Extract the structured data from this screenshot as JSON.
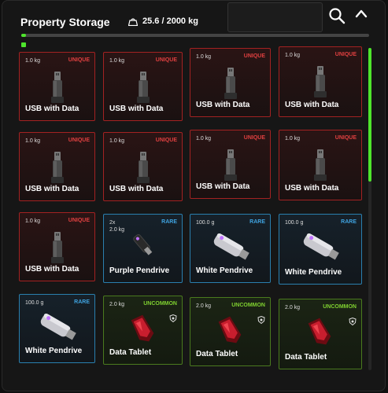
{
  "header": {
    "title": "Property Storage",
    "weight_text": "25.6 / 2000 kg",
    "search_placeholder": ""
  },
  "capacity": {
    "used_kg": 25.6,
    "max_kg": 2000
  },
  "colors": {
    "accent": "#4ee52c",
    "unique": "#e04040",
    "rare": "#3fa3e0",
    "uncommon": "#7fd030"
  },
  "items": [
    {
      "weight": "1.0 kg",
      "rarity": "UNIQUE",
      "name": "USB with Data",
      "icon": "usb-drive-icon"
    },
    {
      "weight": "1.0 kg",
      "rarity": "UNIQUE",
      "name": "USB with Data",
      "icon": "usb-drive-icon"
    },
    {
      "weight": "1.0 kg",
      "rarity": "UNIQUE",
      "name": "USB with Data",
      "icon": "usb-drive-icon"
    },
    {
      "weight": "1.0 kg",
      "rarity": "UNIQUE",
      "name": "USB with Data",
      "icon": "usb-drive-icon"
    },
    {
      "weight": "1.0 kg",
      "rarity": "UNIQUE",
      "name": "USB with Data",
      "icon": "usb-drive-icon"
    },
    {
      "weight": "1.0 kg",
      "rarity": "UNIQUE",
      "name": "USB with Data",
      "icon": "usb-drive-icon"
    },
    {
      "weight": "1.0 kg",
      "rarity": "UNIQUE",
      "name": "USB with Data",
      "icon": "usb-drive-icon"
    },
    {
      "weight": "1.0 kg",
      "rarity": "UNIQUE",
      "name": "USB with Data",
      "icon": "usb-drive-icon"
    },
    {
      "weight": "1.0 kg",
      "rarity": "UNIQUE",
      "name": "USB with Data",
      "icon": "usb-drive-icon"
    },
    {
      "count": "2x",
      "weight": "2.0 kg",
      "rarity": "RARE",
      "name": "Purple Pendrive",
      "icon": "purple-pendrive-icon"
    },
    {
      "weight": "100.0 g",
      "rarity": "RARE",
      "name": "White Pendrive",
      "icon": "white-pendrive-icon"
    },
    {
      "weight": "100.0 g",
      "rarity": "RARE",
      "name": "White Pendrive",
      "icon": "white-pendrive-icon"
    },
    {
      "weight": "100.0 g",
      "rarity": "RARE",
      "name": "White Pendrive",
      "icon": "white-pendrive-icon"
    },
    {
      "weight": "2.0 kg",
      "rarity": "UNCOMMON",
      "name": "Data Tablet",
      "icon": "data-tablet-icon"
    },
    {
      "weight": "2.0 kg",
      "rarity": "UNCOMMON",
      "name": "Data Tablet",
      "icon": "data-tablet-icon"
    },
    {
      "weight": "2.0 kg",
      "rarity": "UNCOMMON",
      "name": "Data Tablet",
      "icon": "data-tablet-icon"
    }
  ]
}
